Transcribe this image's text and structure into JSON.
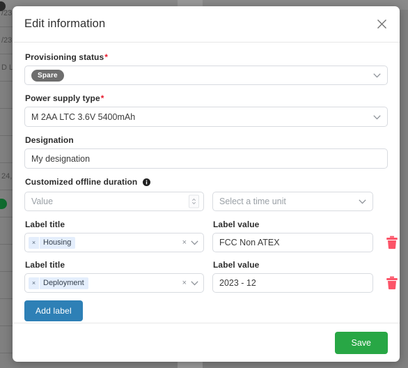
{
  "backdrop": {
    "rows": [
      {
        "text": "/23"
      },
      {
        "text": "/23"
      },
      {
        "text": "D LT"
      },
      {
        "text": ""
      },
      {
        "text": ""
      },
      {
        "text": ""
      },
      {
        "text": "24,"
      },
      {
        "text": ""
      },
      {
        "text": ""
      },
      {
        "text": ""
      },
      {
        "text": ""
      },
      {
        "text": ""
      },
      {
        "text": ""
      }
    ],
    "badge_row_index": 7
  },
  "modal": {
    "title": "Edit information",
    "close_icon": "close-icon",
    "fields": {
      "provisioning_status": {
        "label": "Provisioning status",
        "required": true,
        "required_marker": "*",
        "tag": "Spare",
        "chevron_icon": "chevron-down-icon"
      },
      "power_supply_type": {
        "label": "Power supply type",
        "required": true,
        "required_marker": "*",
        "value": "M 2AA LTC 3.6V 5400mAh",
        "chevron_icon": "chevron-down-icon"
      },
      "designation": {
        "label": "Designation",
        "required": false,
        "value": "My designation"
      },
      "customized_offline_duration": {
        "label": "Customized offline duration",
        "required": false,
        "info_icon": "info-icon",
        "value_placeholder": "Value",
        "value": "",
        "stepper_icon": "stepper-icon",
        "time_unit_placeholder": "Select a time unit",
        "time_unit_value": "",
        "chevron_icon": "chevron-down-icon"
      }
    },
    "labels_section": {
      "title_label": "Label title",
      "value_label": "Label value",
      "rows": [
        {
          "title_chip": "Housing",
          "chip_remove_icon": "chip-remove-icon",
          "clear_icon": "clear-icon",
          "chevron_icon": "chevron-down-icon",
          "value": "FCC Non ATEX",
          "delete_icon": "trash-icon"
        },
        {
          "title_chip": "Deployment",
          "chip_remove_icon": "chip-remove-icon",
          "clear_icon": "clear-icon",
          "chevron_icon": "chevron-down-icon",
          "value": "2023 - 12",
          "delete_icon": "trash-icon"
        }
      ],
      "add_label_button": "Add label"
    },
    "footer": {
      "save_label": "Save"
    }
  },
  "colors": {
    "save_green": "#28a745",
    "add_blue": "#2e80b6",
    "trash_red": "#fc5468",
    "required_red": "#e8192c",
    "tag_gray": "#6e6e6e",
    "chip_blue": "#e4eefc",
    "overlay_gray": "#808080"
  }
}
